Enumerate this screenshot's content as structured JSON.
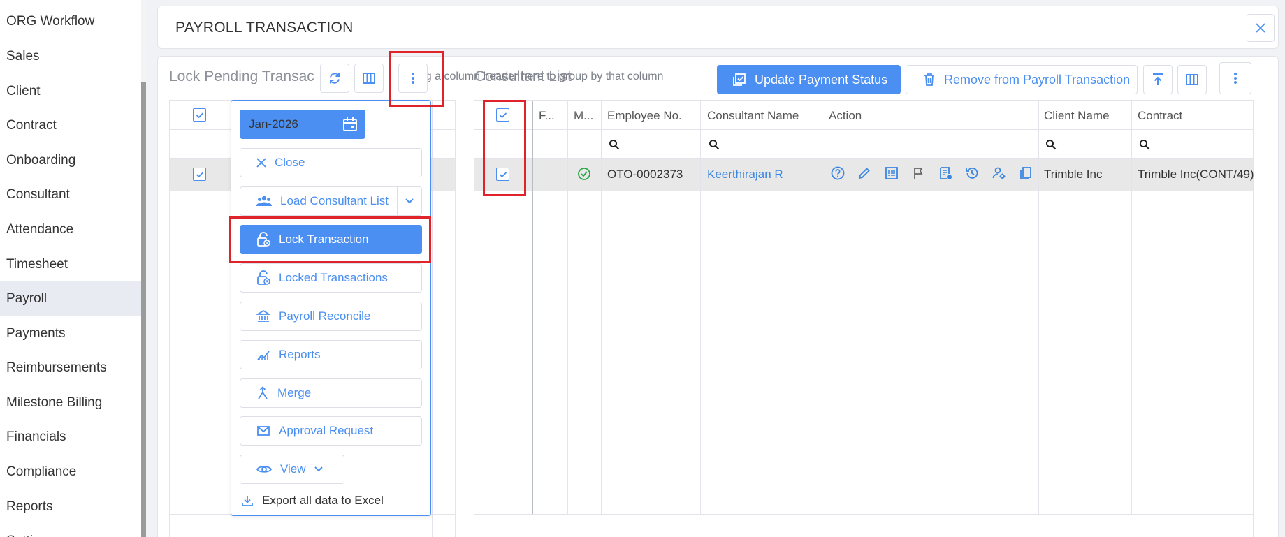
{
  "sidebar": {
    "items": [
      {
        "label": "ORG Workflow"
      },
      {
        "label": "Sales"
      },
      {
        "label": "Client"
      },
      {
        "label": "Contract"
      },
      {
        "label": "Onboarding"
      },
      {
        "label": "Consultant"
      },
      {
        "label": "Attendance"
      },
      {
        "label": "Timesheet"
      },
      {
        "label": "Payroll",
        "active": true
      },
      {
        "label": "Payments"
      },
      {
        "label": "Reimbursements"
      },
      {
        "label": "Milestone Billing"
      },
      {
        "label": "Financials"
      },
      {
        "label": "Compliance"
      },
      {
        "label": "Reports"
      },
      {
        "label": "Settings"
      }
    ]
  },
  "header": {
    "title": "PAYROLL TRANSACTION"
  },
  "left_panel": {
    "title": "Lock Pending Transac",
    "drag_hint": "Drag a column header here to group by that column"
  },
  "right_panel": {
    "title": "Consultant List",
    "update_status_label": "Update Payment Status",
    "remove_label": "Remove from Payroll Transaction"
  },
  "popup": {
    "month": "Jan-2026",
    "close_label": "Close",
    "load_label": "Load Consultant List",
    "lock_label": "Lock Transaction",
    "locked_label": "Locked Transactions",
    "reconcile_label": "Payroll Reconcile",
    "reports_label": "Reports",
    "merge_label": "Merge",
    "approval_label": "Approval Request",
    "view_label": "View",
    "export_label": "Export all data to Excel"
  },
  "grid": {
    "columns": {
      "f": "F...",
      "m": "M...",
      "employee_no": "Employee No.",
      "consultant_name": "Consultant Name",
      "action": "Action",
      "client_name": "Client Name",
      "contract": "Contract"
    },
    "rows": [
      {
        "employee_no": "OTO-0002373",
        "consultant_name": "Keerthirajan R",
        "client_name": "Trimble Inc",
        "contract": "Trimble Inc(CONT/49)"
      }
    ]
  },
  "colors": {
    "accent": "#4b8ff2",
    "highlight": "#e0222a",
    "success": "#28a745"
  }
}
